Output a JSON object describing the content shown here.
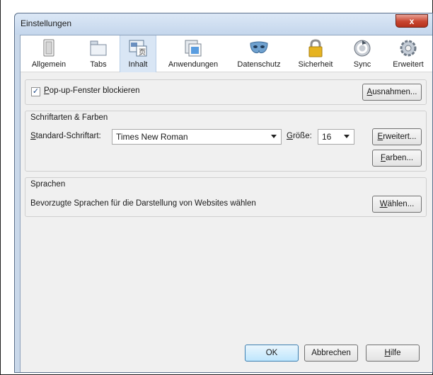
{
  "window": {
    "title": "Einstellungen",
    "close_glyph": "x"
  },
  "toolbar": {
    "items": [
      {
        "label": "Allgemein",
        "icon": "switch-icon"
      },
      {
        "label": "Tabs",
        "icon": "tabs-icon"
      },
      {
        "label": "Inhalt",
        "icon": "content-icon",
        "selected": true
      },
      {
        "label": "Anwendungen",
        "icon": "applications-icon"
      },
      {
        "label": "Datenschutz",
        "icon": "mask-icon"
      },
      {
        "label": "Sicherheit",
        "icon": "lock-icon"
      },
      {
        "label": "Sync",
        "icon": "sync-icon"
      },
      {
        "label": "Erweitert",
        "icon": "gear-icon"
      }
    ]
  },
  "popup": {
    "checkbox_label_ul": "P",
    "checkbox_label_rest": "op-up-Fenster blockieren",
    "checked": true,
    "exceptions_ul": "A",
    "exceptions_rest": "usnahmen..."
  },
  "fonts": {
    "group_title": "Schriftarten & Farben",
    "default_font_ul": "S",
    "default_font_rest": "tandard-Schriftart:",
    "font_value": "Times New Roman",
    "size_ul": "G",
    "size_rest": "röße:",
    "size_value": "16",
    "advanced_ul": "E",
    "advanced_rest": "rweitert...",
    "colors_ul": "F",
    "colors_rest": "arben..."
  },
  "languages": {
    "group_title": "Sprachen",
    "description": "Bevorzugte Sprachen für die Darstellung von Websites wählen",
    "choose_ul": "W",
    "choose_rest": "ählen..."
  },
  "footer": {
    "ok": "OK",
    "cancel": "Abbrechen",
    "help_ul": "H",
    "help_rest": "ilfe"
  }
}
